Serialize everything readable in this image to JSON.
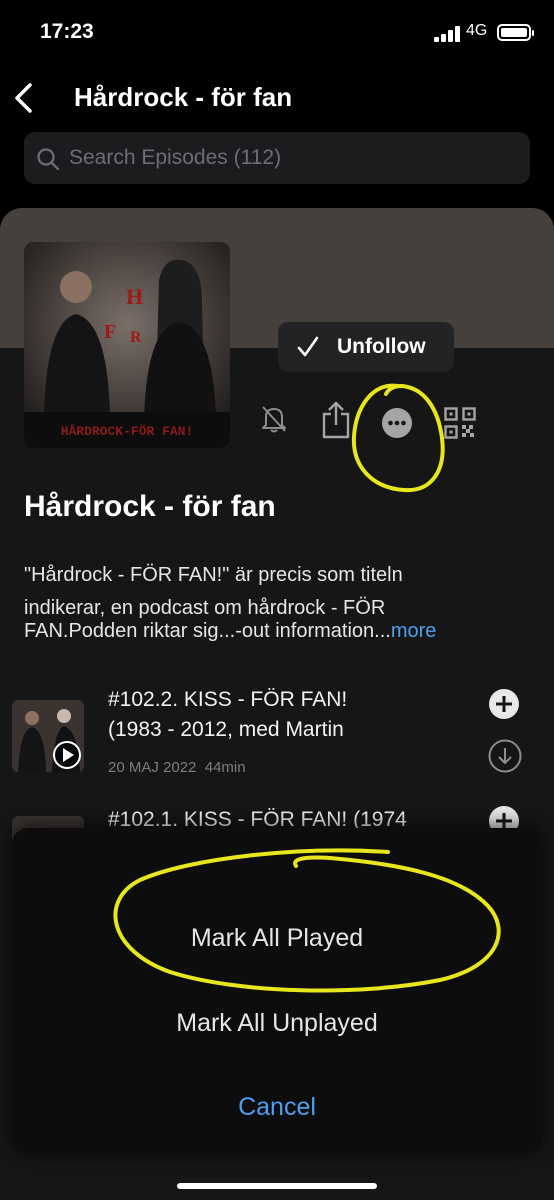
{
  "status_bar": {
    "time": "17:23",
    "network": "4G"
  },
  "nav": {
    "title": "Hårdrock - för fan"
  },
  "search": {
    "placeholder": "Search Episodes (112)"
  },
  "podcast": {
    "artwork_caption": "HÅRDROCK-FÖR FAN!",
    "unfollow_label": "Unfollow",
    "title": "Hårdrock - för fan",
    "description_lines": [
      "\"Hårdrock - FÖR FAN!\" är precis som titeln",
      "indikerar, en podcast om hårdrock - FÖR",
      "FAN.Podden riktar sig...-out information..."
    ],
    "more_label": "more"
  },
  "episodes": [
    {
      "title_lines": [
        "#102.2. KISS - FÖR FAN!",
        "(1983 - 2012, med Martin"
      ],
      "date": "20 MAJ 2022",
      "duration": "44min"
    },
    {
      "title_lines": [
        "#102.1. KISS - FÖR FAN! (1974"
      ]
    }
  ],
  "action_sheet": {
    "items": [
      "Mark All Played",
      "Mark All Unplayed"
    ],
    "cancel_label": "Cancel"
  },
  "colors": {
    "accent": "#4d9ff0",
    "background": "#000000",
    "card": "#161616",
    "banner": "#45403c",
    "highlight_markup": "#e8e61c"
  }
}
